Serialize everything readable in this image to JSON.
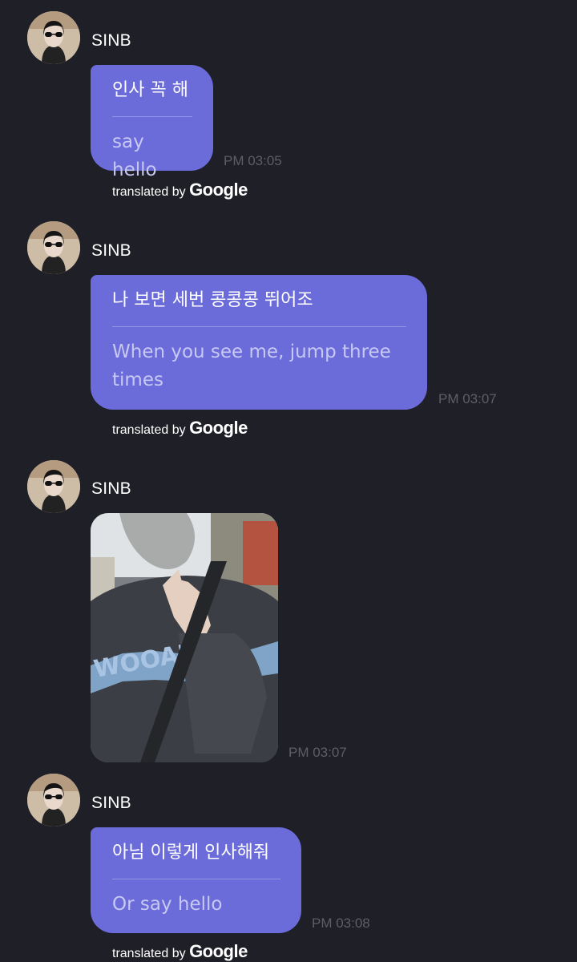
{
  "messages": [
    {
      "sender": "SINB",
      "original": "인사 꼭 해",
      "translation": "say hello",
      "time": "PM 03:05",
      "credit_prefix": "translated by",
      "credit_brand": "Google"
    },
    {
      "sender": "SINB",
      "original": "나 보면 세번 콩콩콩 뛰어조",
      "translation": "When you see me, jump three times",
      "time": "PM 03:07",
      "credit_prefix": "translated by",
      "credit_brand": "Google"
    },
    {
      "sender": "SINB",
      "photo_label": "WOOAHNG",
      "time": "PM 03:07"
    },
    {
      "sender": "SINB",
      "original": "아님 이렇게 인사해줘",
      "translation": "Or say hello",
      "time": "PM 03:08",
      "credit_prefix": "translated by",
      "credit_brand": "Google"
    }
  ],
  "colors": {
    "background": "#1f1f27",
    "bubble": "#6b6cda",
    "translation_text": "#c7c8f3",
    "timestamp": "#5d5e69"
  }
}
